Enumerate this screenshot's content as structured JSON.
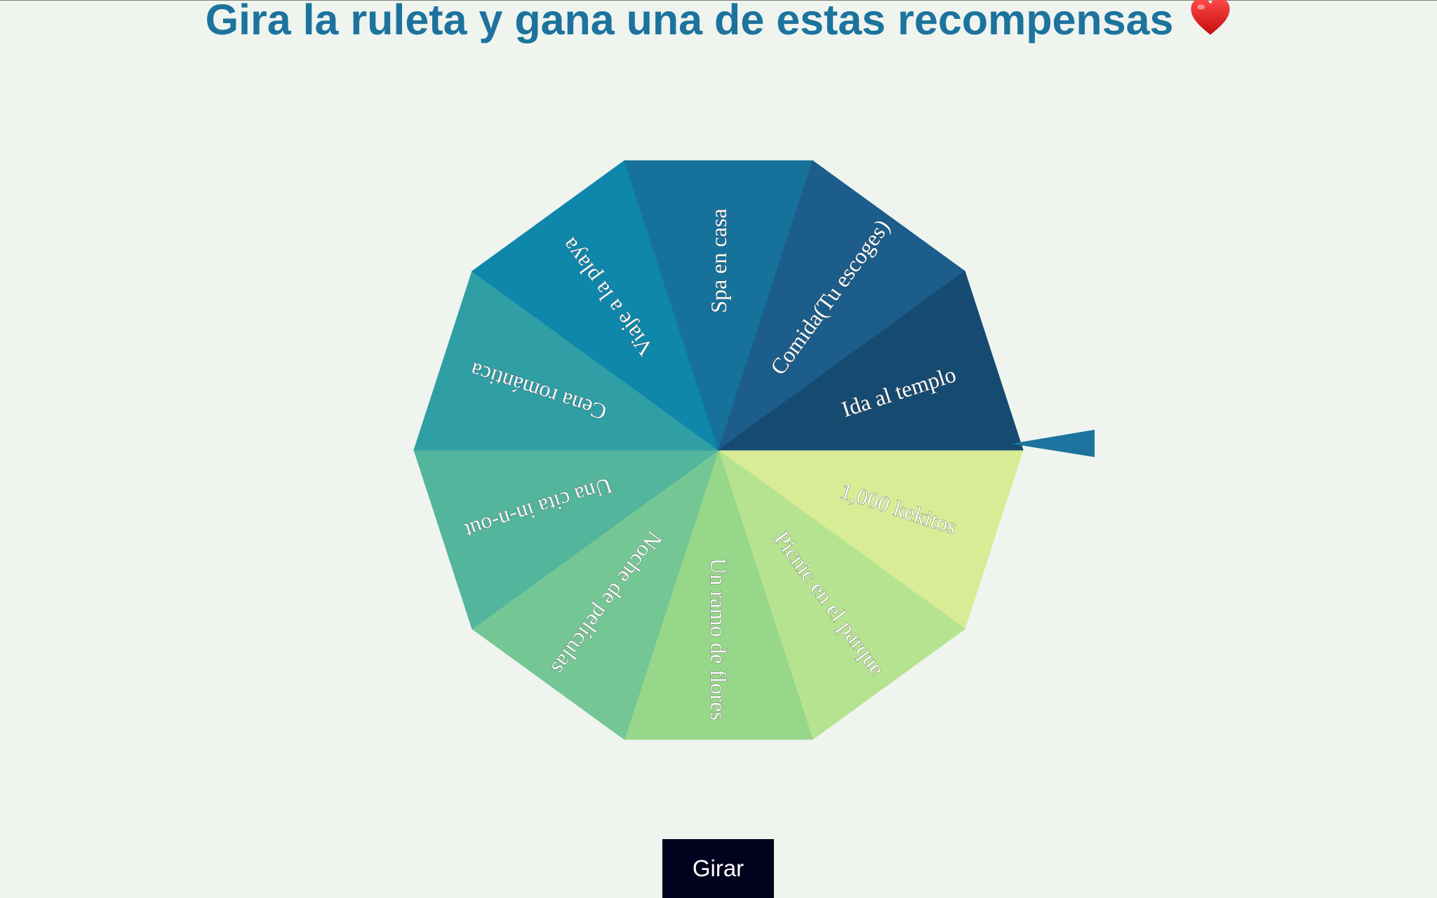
{
  "page": {
    "title": "Gira la ruleta y gana una de estas recompensas",
    "title_emoji": "heart-icon"
  },
  "wheel": {
    "pointer_color": "#1c739d",
    "segments": [
      {
        "label": "1,000 kekitos",
        "color": "#d8ec95"
      },
      {
        "label": "Picnic en el parque",
        "color": "#b6e38f"
      },
      {
        "label": "Un ramo de flores",
        "color": "#97d78a"
      },
      {
        "label": "Noche de películas",
        "color": "#74c795"
      },
      {
        "label": "Una cita in-n-out",
        "color": "#52b59c"
      },
      {
        "label": "Cena romántica",
        "color": "#2f9ea5"
      },
      {
        "label": "Viaje a la playa",
        "color": "#0e87ab"
      },
      {
        "label": "Spa en casa",
        "color": "#16729b"
      },
      {
        "label": "Comida(Tu escoges)",
        "color": "#1c5d8b"
      },
      {
        "label": "Ida al templo",
        "color": "#164b71"
      }
    ]
  },
  "controls": {
    "spin_label": "Girar"
  },
  "colors": {
    "background": "#eff4ef",
    "title": "#1c739d",
    "button_bg": "#02021e",
    "button_text": "#ffffff"
  }
}
